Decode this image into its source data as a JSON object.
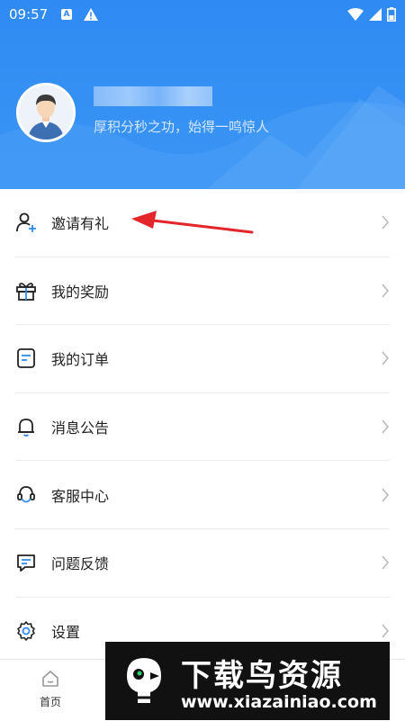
{
  "status_bar": {
    "time": "09:57",
    "a_badge": "A"
  },
  "profile": {
    "slogan": "厚积分秒之功，始得一鸣惊人"
  },
  "menu": [
    {
      "label": "邀请有礼",
      "icon": "invite-user-icon"
    },
    {
      "label": "我的奖励",
      "icon": "gift-icon"
    },
    {
      "label": "我的订单",
      "icon": "order-icon"
    },
    {
      "label": "消息公告",
      "icon": "bell-icon"
    },
    {
      "label": "客服中心",
      "icon": "customer-service-icon"
    },
    {
      "label": "问题反馈",
      "icon": "feedback-icon"
    },
    {
      "label": "设置",
      "icon": "gear-icon"
    }
  ],
  "bottom_nav": {
    "home_label": "首页"
  },
  "watermark": {
    "title": "下载鸟资源",
    "url": "www.xiazainiao.com"
  },
  "colors": {
    "header_blue": "#2f8bf2",
    "arrow_red": "#e3262a",
    "text": "#222222"
  }
}
